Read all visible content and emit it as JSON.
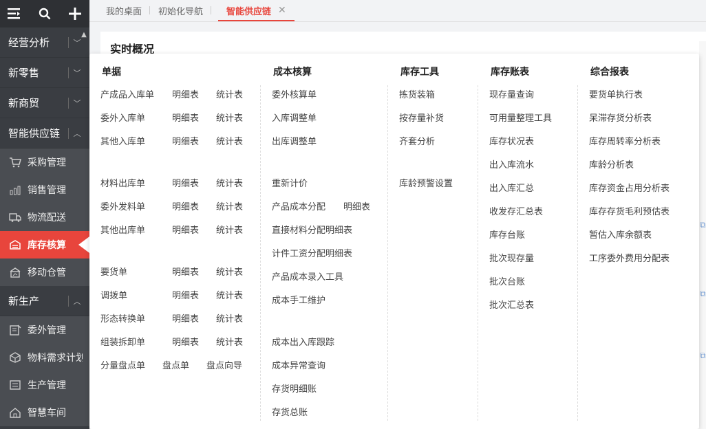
{
  "sidebar": {
    "categories": [
      {
        "label": "经营分析"
      },
      {
        "label": "新零售"
      },
      {
        "label": "新商贸"
      },
      {
        "label": "智能供应链"
      },
      {
        "label": "新生产"
      }
    ],
    "supply_items": [
      {
        "label": "采购管理",
        "icon": "cart-icon"
      },
      {
        "label": "销售管理",
        "icon": "sales-chart-icon"
      },
      {
        "label": "物流配送",
        "icon": "truck-icon"
      },
      {
        "label": "库存核算",
        "icon": "inventory-icon"
      },
      {
        "label": "移动仓管",
        "icon": "mobile-warehouse-icon"
      }
    ],
    "production_items": [
      {
        "label": "委外管理",
        "icon": "outsource-icon"
      },
      {
        "label": "物料需求计划",
        "icon": "cube-icon"
      },
      {
        "label": "生产管理",
        "icon": "production-icon"
      },
      {
        "label": "智慧车间",
        "icon": "workshop-icon"
      }
    ]
  },
  "tabs": [
    {
      "label": "我的桌面"
    },
    {
      "label": "初始化导航"
    },
    {
      "label": "智能供应链"
    }
  ],
  "main": {
    "title": "实时概况"
  },
  "menu": {
    "col1": {
      "header": "单据",
      "rows": [
        [
          "产成品入库单",
          "明细表",
          "统计表"
        ],
        [
          "委外入库单",
          "明细表",
          "统计表"
        ],
        [
          "其他入库单",
          "明细表",
          "统计表"
        ],
        [
          "材料出库单",
          "明细表",
          "统计表"
        ],
        [
          "委外发料单",
          "明细表",
          "统计表"
        ],
        [
          "其他出库单",
          "明细表",
          "统计表"
        ],
        [
          "要货单",
          "明细表",
          "统计表"
        ],
        [
          "调拨单",
          "明细表",
          "统计表"
        ],
        [
          "形态转换单",
          "明细表",
          "统计表"
        ],
        [
          "组装拆卸单",
          "明细表",
          "统计表"
        ],
        [
          "分量盘点单",
          "盘点单",
          "盘点向导"
        ]
      ]
    },
    "col2": {
      "header": "成本核算",
      "items": [
        "委外核算单",
        "入库调整单",
        "出库调整单",
        "重新计价",
        "产品成本分配",
        "直接材料分配明细表",
        "计件工资分配明细表",
        "产品成本录入工具",
        "成本手工维护",
        "成本出入库跟踪",
        "成本异常查询",
        "存货明细账",
        "存货总账"
      ],
      "extra": "明细表"
    },
    "col3": {
      "header": "库存工具",
      "items": [
        "拣货装箱",
        "按存量补货",
        "齐套分析",
        "库龄预警设置"
      ]
    },
    "col4": {
      "header": "库存账表",
      "items": [
        "现存量查询",
        "可用量整理工具",
        "库存状况表",
        "出入库流水",
        "出入库汇总",
        "收发存汇总表",
        "库存台账",
        "批次现存量",
        "批次台账",
        "批次汇总表"
      ]
    },
    "col5": {
      "header": "综合报表",
      "items": [
        "要货单执行表",
        "呆滞存货分析表",
        "库存周转率分析表",
        "库龄分析表",
        "库存资金占用分析表",
        "库存存货毛利预估表",
        "暂估入库余额表",
        "工序委外费用分配表"
      ]
    }
  },
  "colors": {
    "accent": "#e8453c",
    "sidebar_bg": "#3a3d42"
  }
}
